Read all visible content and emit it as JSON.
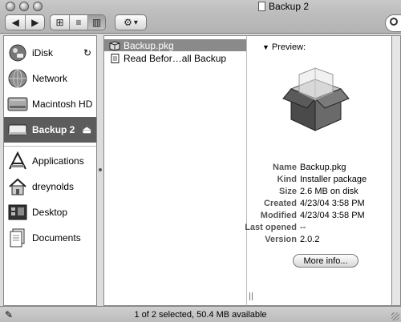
{
  "window": {
    "title": "Backup 2",
    "toolbar": {
      "back_glyph": "◀",
      "forward_glyph": "▶",
      "view_icon_glyph": "⊞",
      "view_list_glyph": "≡",
      "view_column_glyph": "▥",
      "action_glyph": "⚙",
      "action_arrow": "▾",
      "selected_view": "column"
    }
  },
  "sidebar": {
    "items": [
      {
        "label": "iDisk",
        "icon": "idisk-icon",
        "badge_glyph": "↻"
      },
      {
        "label": "Network",
        "icon": "network-globe-icon"
      },
      {
        "label": "Macintosh HD",
        "icon": "hard-drive-icon"
      },
      {
        "label": "Backup 2",
        "icon": "removable-disk-icon",
        "badge_glyph": "⏏",
        "selected": true
      },
      {
        "label": "Applications",
        "icon": "applications-icon"
      },
      {
        "label": "dreynolds",
        "icon": "home-icon"
      },
      {
        "label": "Desktop",
        "icon": "desktop-icon"
      },
      {
        "label": "Documents",
        "icon": "documents-icon"
      }
    ]
  },
  "files": [
    {
      "name": "Backup.pkg",
      "icon": "package-icon",
      "selected": true
    },
    {
      "name": "Read Befor…all Backup",
      "icon": "document-icon",
      "selected": false
    }
  ],
  "preview": {
    "header": "Preview:",
    "header_glyph": "▼",
    "fields": [
      {
        "key": "Name",
        "value": "Backup.pkg"
      },
      {
        "key": "Kind",
        "value": "Installer package"
      },
      {
        "key": "Size",
        "value": "2.6 MB on disk"
      },
      {
        "key": "Created",
        "value": "4/23/04 3:58 PM"
      },
      {
        "key": "Modified",
        "value": "4/23/04 3:58 PM"
      },
      {
        "key": "Last opened",
        "value": "--"
      },
      {
        "key": "Version",
        "value": "2.0.2"
      }
    ],
    "more_info_label": "More info..."
  },
  "status": {
    "text": "1 of 2 selected, 50.4 MB available"
  },
  "colors": {
    "selected_sidebar": "#5c5c5c",
    "selected_row": "#8a8a8a"
  }
}
